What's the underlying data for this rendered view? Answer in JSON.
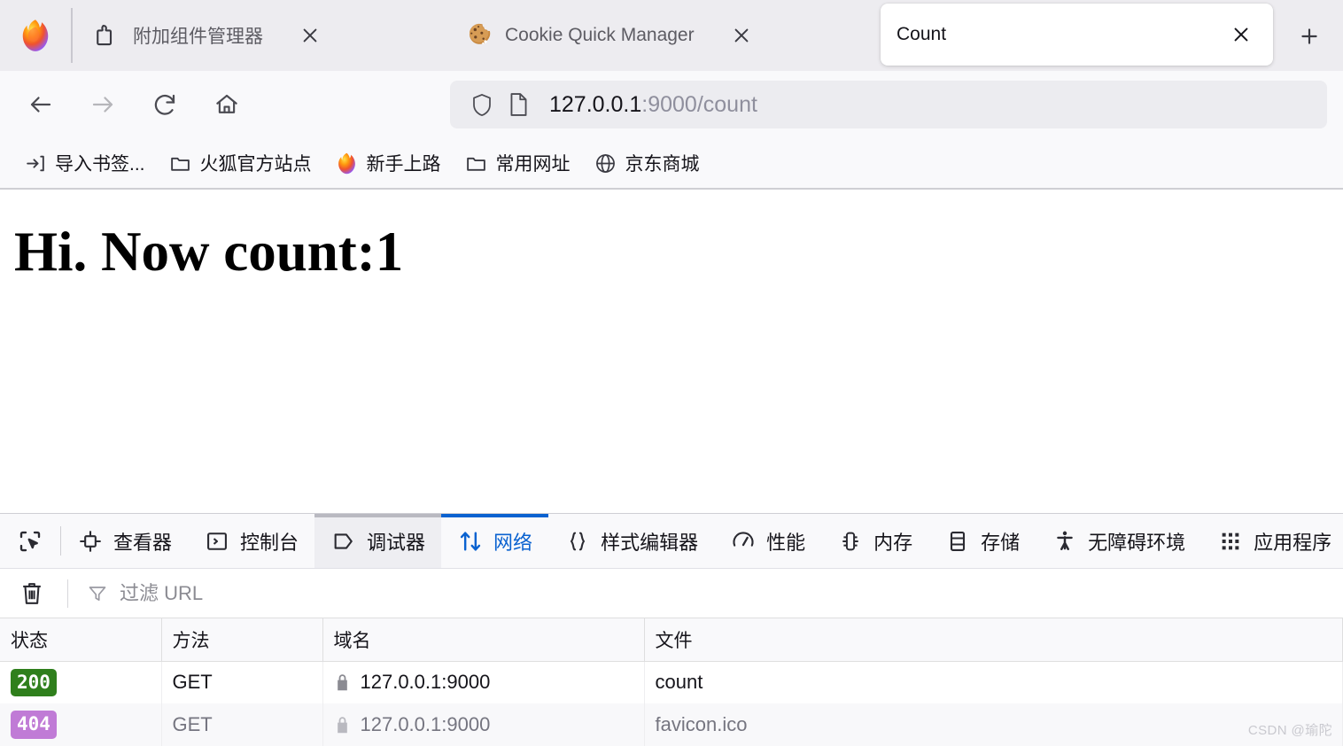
{
  "window": {
    "tabs": [
      {
        "title": "附加组件管理器",
        "icon": "puzzle-piece-icon",
        "active": false,
        "close_label": "×"
      },
      {
        "title": "Cookie Quick Manager",
        "icon": "cookie-icon",
        "active": false,
        "close_label": "×"
      },
      {
        "title": "Count",
        "icon": "none",
        "active": true,
        "close_label": "×"
      }
    ],
    "new_tab_label": "+",
    "logo": "firefox-logo"
  },
  "navbar": {
    "back": "back-arrow-icon",
    "forward": "forward-arrow-icon",
    "reload": "reload-icon",
    "home": "home-icon",
    "url_host": "127.0.0.1",
    "url_rest": ":9000/count",
    "shield": "shield-icon",
    "page_icon": "page-document-icon"
  },
  "bookmarks": [
    {
      "label": "导入书签...",
      "icon": "import-bookmarks-icon"
    },
    {
      "label": "火狐官方站点",
      "icon": "folder-icon"
    },
    {
      "label": "新手上路",
      "icon": "firefox-logo-icon"
    },
    {
      "label": "常用网址",
      "icon": "folder-icon"
    },
    {
      "label": "京东商城",
      "icon": "globe-icon"
    }
  ],
  "page": {
    "heading": "Hi. Now count:1"
  },
  "devtools": {
    "picker_icon": "element-picker-icon",
    "tabs": [
      {
        "label": "查看器",
        "icon": "inspector-icon",
        "state": "normal"
      },
      {
        "label": "控制台",
        "icon": "console-icon",
        "state": "normal"
      },
      {
        "label": "调试器",
        "icon": "debugger-icon",
        "state": "hovered"
      },
      {
        "label": "网络",
        "icon": "network-icon",
        "state": "active"
      },
      {
        "label": "样式编辑器",
        "icon": "style-editor-icon",
        "state": "normal"
      },
      {
        "label": "性能",
        "icon": "performance-icon",
        "state": "normal"
      },
      {
        "label": "内存",
        "icon": "memory-icon",
        "state": "normal"
      },
      {
        "label": "存储",
        "icon": "storage-icon",
        "state": "normal"
      },
      {
        "label": "无障碍环境",
        "icon": "accessibility-icon",
        "state": "normal"
      },
      {
        "label": "应用程序",
        "icon": "application-icon",
        "state": "normal"
      }
    ],
    "toolbar": {
      "clear_icon": "trash-icon",
      "filter_icon": "funnel-icon",
      "filter_placeholder": "过滤 URL",
      "filter_value": ""
    },
    "network_table": {
      "columns": [
        "状态",
        "方法",
        "域名",
        "文件"
      ],
      "rows": [
        {
          "status": "200",
          "status_color": "#2f7f1c",
          "method": "GET",
          "domain": "127.0.0.1:9000",
          "file": "count",
          "secure_icon": "lock-icon",
          "dim": false
        },
        {
          "status": "404",
          "status_color": "#c07bd6",
          "method": "GET",
          "domain": "127.0.0.1:9000",
          "file": "favicon.ico",
          "secure_icon": "lock-icon",
          "dim": true
        }
      ]
    }
  },
  "watermark": "CSDN @瑜陀"
}
